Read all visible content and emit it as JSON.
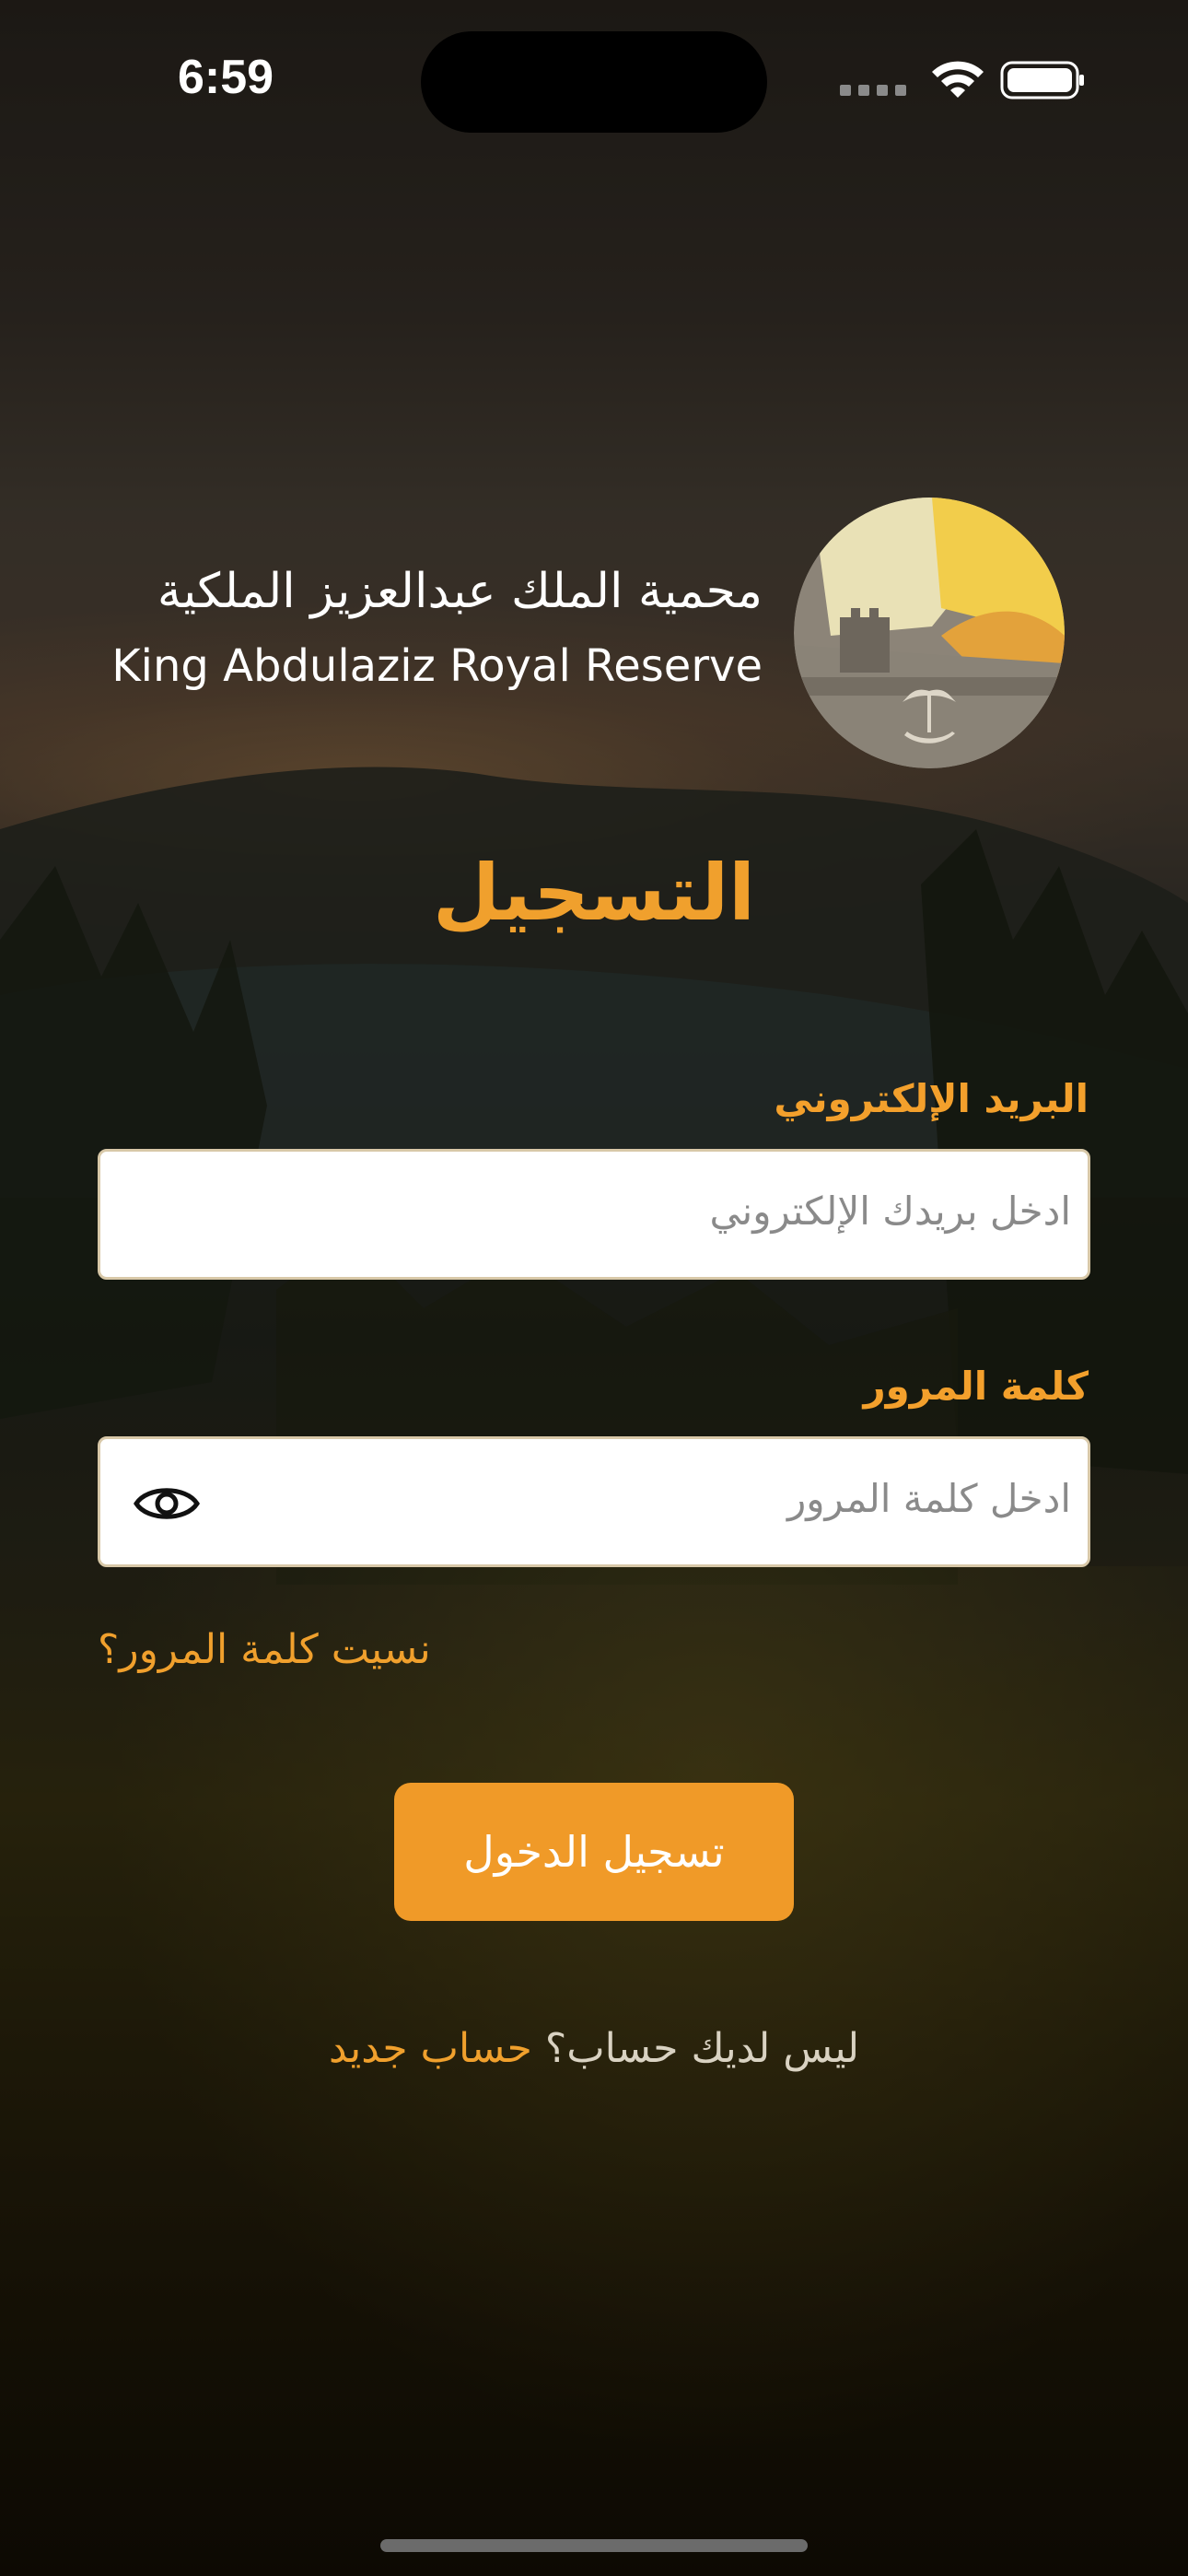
{
  "status_bar": {
    "time": "6:59",
    "icons": [
      "cellular-dots-icon",
      "wifi-icon",
      "battery-icon"
    ]
  },
  "brand": {
    "name_ar": "محمية الملك عبدالعزيز الملكية",
    "name_en": "King Abdulaziz Royal Reserve",
    "logo_icon": "reserve-logo-icon"
  },
  "page": {
    "title": "التسجيل"
  },
  "form": {
    "email_label": "البريد الإلكتروني",
    "email_placeholder": "ادخل بريدك الإلكتروني",
    "password_label": "كلمة المرور",
    "password_placeholder": "ادخل كلمة المرور",
    "password_toggle_icon": "eye-icon",
    "forgot_password": "نسيت كلمة المرور؟",
    "login_button": "تسجيل الدخول"
  },
  "signup": {
    "question": "ليس لديك حساب؟",
    "link": "حساب جديد"
  },
  "colors": {
    "accent": "#f09a28",
    "input_bg": "#ffffff",
    "placeholder": "#8a8a8a",
    "text_light": "#ffffff"
  }
}
